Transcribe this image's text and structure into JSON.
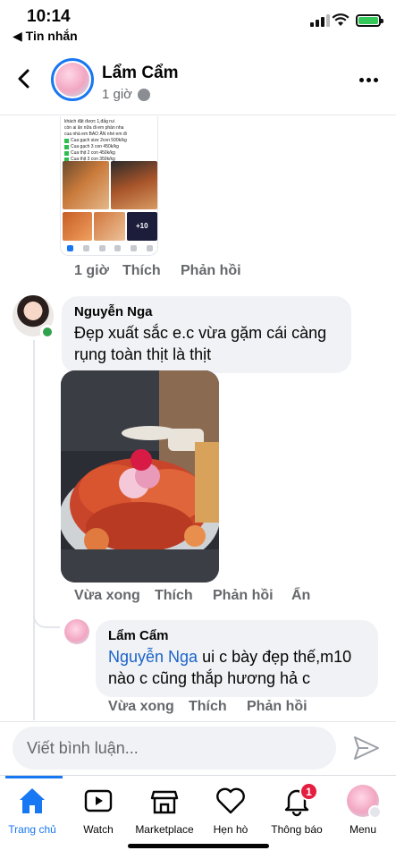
{
  "status": {
    "time": "10:14",
    "back_app": "◀ Tin nhắn"
  },
  "header": {
    "name": "Lẩm Cẩm",
    "time": "1 giờ"
  },
  "post_image": {
    "lines": [
      "khách đặt được 1,đấg rui",
      "còn ai ăn nữa đi em phần nha",
      "cua nhà em BAO ĂN nhé em đi"
    ],
    "items": [
      "Cua gạch size 2con 500k/kg",
      "Cua gạch 3 con 450k/kg",
      "Cua thịt 2 con 450k/kg",
      "Cua thịt 3 con 350k/kg"
    ],
    "badge": "+10"
  },
  "post_actions": {
    "time": "1 giờ",
    "like": "Thích",
    "reply": "Phản hồi"
  },
  "comments": [
    {
      "author": "Nguyễn Nga",
      "text": "Đẹp xuất sắc e.c vừa gặm cái càng rụng toàn thịt là thịt",
      "time": "Vừa xong",
      "like": "Thích",
      "reply": "Phản hồi",
      "hide": "Ẩn"
    }
  ],
  "reply": {
    "author": "Lẩm Cẩm",
    "mention": "Nguyễn Nga",
    "text": " ui c bày đẹp thế,m10 nào c cũng thắp hương hả c",
    "time": "Vừa xong",
    "like": "Thích",
    "reply": "Phản hồi"
  },
  "comment_input": {
    "placeholder": "Viết bình luận..."
  },
  "tabs": [
    {
      "label": "Trang chủ",
      "icon": "home-icon",
      "active": true
    },
    {
      "label": "Watch",
      "icon": "watch-icon"
    },
    {
      "label": "Marketplace",
      "icon": "marketplace-icon"
    },
    {
      "label": "Hẹn hò",
      "icon": "heart-icon"
    },
    {
      "label": "Thông báo",
      "icon": "bell-icon",
      "badge": "1"
    },
    {
      "label": "Menu",
      "icon": "profile-icon"
    }
  ],
  "colors": {
    "accent": "#1877f2",
    "badge": "#e41e3f",
    "mention": "#1b63c9"
  }
}
